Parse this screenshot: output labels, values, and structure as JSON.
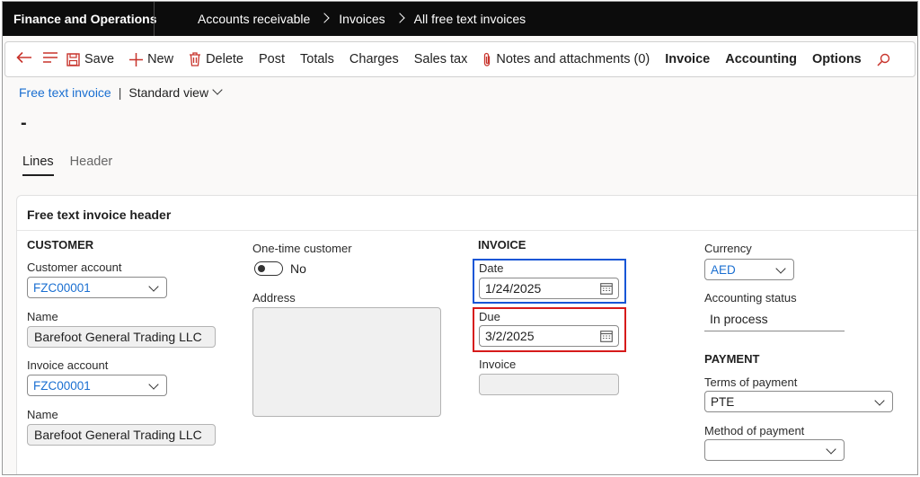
{
  "topbar": {
    "app_title": "Finance and Operations",
    "breadcrumbs": [
      "Accounts receivable",
      "Invoices",
      "All free text invoices"
    ]
  },
  "actions": {
    "save": "Save",
    "new": "New",
    "delete": "Delete",
    "post": "Post",
    "totals": "Totals",
    "charges": "Charges",
    "sales_tax": "Sales tax",
    "notes": "Notes and attachments (0)",
    "invoice": "Invoice",
    "accounting": "Accounting",
    "options": "Options"
  },
  "page": {
    "form_link": "Free text invoice",
    "view_name": "Standard view",
    "record_title": "-"
  },
  "tabs": [
    {
      "label": "Lines",
      "active": true
    },
    {
      "label": "Header",
      "active": false
    }
  ],
  "card": {
    "title": "Free text invoice header"
  },
  "customer": {
    "heading": "CUSTOMER",
    "customer_account_label": "Customer account",
    "customer_account_value": "FZC00001",
    "name_label": "Name",
    "name_value": "Barefoot General Trading LLC",
    "invoice_account_label": "Invoice account",
    "invoice_account_value": "FZC00001",
    "name2_label": "Name",
    "name2_value": "Barefoot General Trading LLC"
  },
  "onetime": {
    "label": "One-time customer",
    "toggle_value": "No",
    "address_label": "Address"
  },
  "invoice": {
    "heading": "INVOICE",
    "date_label": "Date",
    "date_value": "1/24/2025",
    "due_label": "Due",
    "due_value": "3/2/2025",
    "invoice_label": "Invoice",
    "invoice_value": ""
  },
  "misc": {
    "currency_label": "Currency",
    "currency_value": "AED",
    "accounting_status_label": "Accounting status",
    "accounting_status_value": "In process"
  },
  "payment": {
    "heading": "PAYMENT",
    "terms_label": "Terms of payment",
    "terms_value": "PTE",
    "method_label": "Method of payment",
    "method_value": ""
  },
  "colors": {
    "topbar_bg": "#0c0c0c",
    "link_blue": "#1a6fd1",
    "icon_red": "#c8342c",
    "highlight_blue": "#1756d6",
    "highlight_red": "#d61b1b"
  }
}
